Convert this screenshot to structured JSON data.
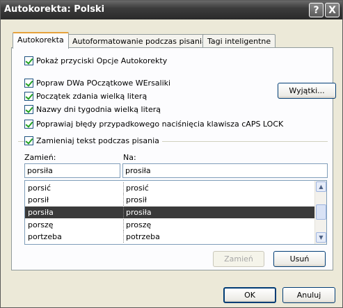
{
  "window": {
    "title": "Autokorekta: Polski",
    "help_button": "?",
    "close_button": "X"
  },
  "tabs": [
    {
      "label": "Autokorekta",
      "active": true
    },
    {
      "label": "Autoformatowanie podczas pisania",
      "active": false
    },
    {
      "label": "Tagi inteligentne",
      "active": false
    }
  ],
  "options": {
    "show_buttons": "Pokaż przyciski Opcje Autokorekty",
    "two_initial_caps": "Popraw DWa POczątkowe WErsaliki",
    "sentence_start": "Początek zdania wielką literą",
    "day_names": "Nazwy dni tygodnia wielką literą",
    "caps_lock": "Poprawiaj błędy przypadkowego naciśnięcia klawisza cAPS LOCK",
    "replace_text": "Zamieniaj tekst podczas pisania"
  },
  "exceptions_button": "Wyjątki...",
  "replace": {
    "from_label": "Zamień:",
    "to_label": "Na:",
    "from_value": "porsiła",
    "to_value": "prosiła"
  },
  "list": [
    {
      "from": "porsić",
      "to": "prosić",
      "selected": false
    },
    {
      "from": "porsił",
      "to": "prosił",
      "selected": false
    },
    {
      "from": "porsiła",
      "to": "prosiła",
      "selected": true
    },
    {
      "from": "porszę",
      "to": "proszę",
      "selected": false
    },
    {
      "from": "portzeba",
      "to": "potrzeba",
      "selected": false
    }
  ],
  "buttons": {
    "replace": "Zamień",
    "delete": "Usuń",
    "ok": "OK",
    "cancel": "Anuluj"
  }
}
